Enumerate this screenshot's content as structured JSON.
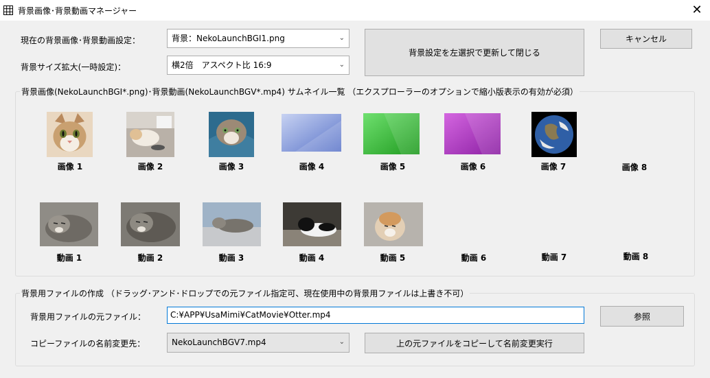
{
  "window": {
    "title": "背景画像･背景動画マネージャー",
    "close": "✕"
  },
  "settings": {
    "current_label": "現在の背景画像･背景動画設定：",
    "current_value": "背景：NekoLaunchBGI1.png",
    "size_label": "背景サイズ拡大(一時設定)：",
    "size_value": "横2倍　アスペクト比 16:9",
    "apply_button": "背景設定を左選択で更新して閉じる",
    "cancel_button": "キャンセル"
  },
  "thumbnails": {
    "group_title": "背景画像(NekoLaunchBGI*.png)･背景動画(NekoLaunchBGV*.mp4) サムネイル一覧 （エクスプローラーのオプションで縮小版表示の有効が必須）",
    "images": [
      {
        "label": "画像 1",
        "kind": "cat-face-photo"
      },
      {
        "label": "画像 2",
        "kind": "cat-desk-photo"
      },
      {
        "label": "画像 3",
        "kind": "cat-blanket-photo"
      },
      {
        "label": "画像 4",
        "kind": "blue-gradient"
      },
      {
        "label": "画像 5",
        "kind": "green-gradient"
      },
      {
        "label": "画像 6",
        "kind": "purple-gradient"
      },
      {
        "label": "画像 7",
        "kind": "earth-photo"
      },
      {
        "label": "画像 8",
        "kind": "empty"
      }
    ],
    "videos": [
      {
        "label": "動画 1",
        "kind": "sleeping-cat-video"
      },
      {
        "label": "動画 2",
        "kind": "sleeping-cat-video"
      },
      {
        "label": "動画 3",
        "kind": "lying-cat-video"
      },
      {
        "label": "動画 4",
        "kind": "black-white-cat-video"
      },
      {
        "label": "動画 5",
        "kind": "orange-cat-video"
      },
      {
        "label": "動画 6",
        "kind": "empty"
      },
      {
        "label": "動画 7",
        "kind": "empty"
      },
      {
        "label": "動画 8",
        "kind": "empty"
      }
    ]
  },
  "create": {
    "group_title": "背景用ファイルの作成 （ドラッグ･アンド･ドロップでの元ファイル指定可、現在使用中の背景用ファイルは上書き不可）",
    "source_label": "背景用ファイルの元ファイル：",
    "source_value": "C:¥APP¥UsaMimi¥CatMovie¥Otter.mp4",
    "browse_button": "参照",
    "rename_label": "コピーファイルの名前変更先：",
    "rename_value": "NekoLaunchBGV7.mp4",
    "copy_button": "上の元ファイルをコピーして名前変更実行"
  }
}
